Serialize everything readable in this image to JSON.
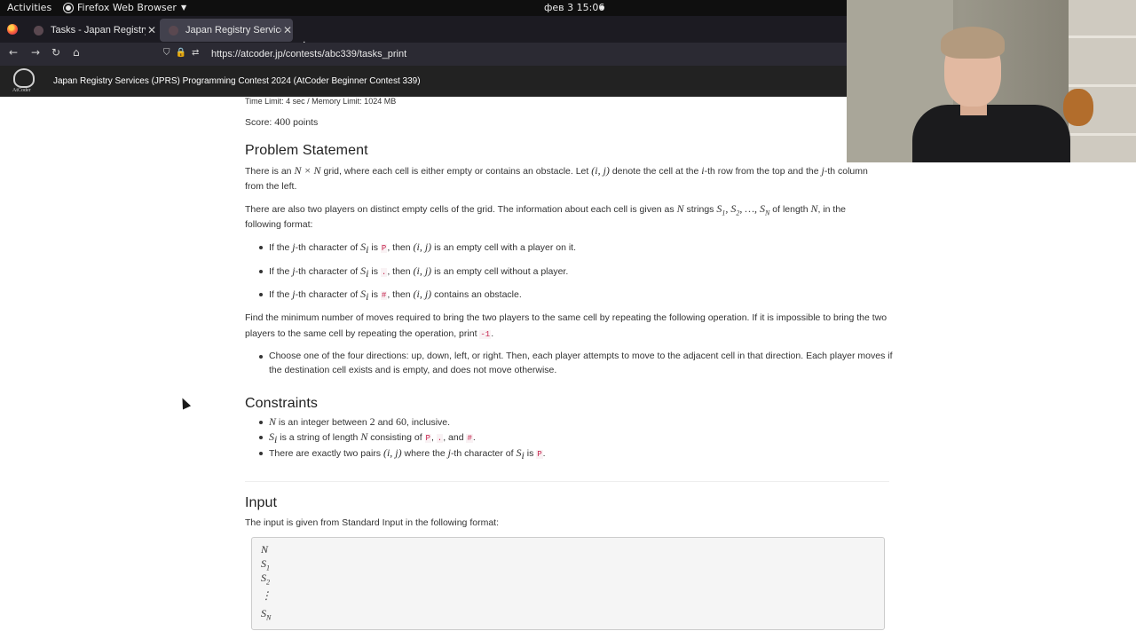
{
  "system_bar": {
    "activities": "Activities",
    "app_name": "Firefox Web Browser",
    "clock": "фев 3  15:06"
  },
  "browser": {
    "tabs": [
      {
        "label": "Tasks - Japan Registry Se",
        "active": false
      },
      {
        "label": "Japan Registry Services (",
        "active": true
      }
    ],
    "url": "https://atcoder.jp/contests/abc339/tasks_print"
  },
  "site_header": {
    "logo_text": "AtCoder",
    "contest_title": "Japan Registry Services (JPRS) Programming Contest 2024 (AtCoder Beginner Contest 339)"
  },
  "problem": {
    "limits": "Time Limit: 4 sec / Memory Limit: 1024 MB",
    "score_prefix": "Score: ",
    "score_value": "400",
    "score_suffix": " points",
    "statement_heading": "Problem Statement",
    "statement_p1": {
      "a": "There is an ",
      "math1": "N × N",
      "b": " grid, where each cell is either empty or contains an obstacle. Let ",
      "math2": "(i, j)",
      "c": " denote the cell at the ",
      "math3": "i",
      "d": "-th row from the top and the ",
      "math4": "j",
      "e": "-th column",
      "line2": "from the left."
    },
    "statement_p2": {
      "a": "There are also two players on distinct empty cells of the grid. The information about each cell is given as ",
      "math1": "N",
      "b": " strings ",
      "math2": "S",
      "c": " of length ",
      "math3": "N",
      "d": ", in the",
      "line2": "following format:"
    },
    "format_items": [
      {
        "a": "If the ",
        "j": "j",
        "b": "-th character of ",
        "s": "S",
        "sub": "i",
        "c": " is ",
        "code": "P",
        "d": ", then ",
        "cell": "(i, j)",
        "e": " is an empty cell with a player on it."
      },
      {
        "a": "If the ",
        "j": "j",
        "b": "-th character of ",
        "s": "S",
        "sub": "i",
        "c": " is ",
        "code": ".",
        "d": ", then ",
        "cell": "(i, j)",
        "e": " is an empty cell without a player."
      },
      {
        "a": "If the ",
        "j": "j",
        "b": "-th character of ",
        "s": "S",
        "sub": "i",
        "c": " is ",
        "code": "#",
        "d": ", then ",
        "cell": "(i, j)",
        "e": " contains an obstacle."
      }
    ],
    "statement_p3": {
      "line1": "Find the minimum number of moves required to bring the two players to the same cell by repeating the following operation. If it is impossible to bring the two",
      "line2a": "players to the same cell by repeating the operation, print ",
      "code": "-1",
      "line2b": "."
    },
    "operation": {
      "line1": "Choose one of the four directions: up, down, left, or right. Then, each player attempts to move to the adjacent cell in that direction. Each player moves if",
      "line2": "the destination cell exists and is empty, and does not move otherwise."
    },
    "constraints_heading": "Constraints",
    "constraints": {
      "c1": {
        "m": "N",
        "a": " is an integer between ",
        "n1": "2",
        "b": " and ",
        "n2": "60",
        "c": ", inclusive."
      },
      "c2": {
        "m": "S",
        "sub": "i",
        "a": " is a string of length ",
        "n": "N",
        "b": " consisting of ",
        "code1": "P",
        "sep1": ", ",
        "code2": ".",
        "sep2": ", and ",
        "code3": "#",
        "c": "."
      },
      "c3": {
        "a": "There are exactly two pairs ",
        "m": "(i, j)",
        "b": " where the ",
        "j": "j",
        "c": "-th character of ",
        "s": "S",
        "sub": "i",
        "d": " is ",
        "code": "P",
        "e": "."
      }
    },
    "input_heading": "Input",
    "input_text": "The input is given from Standard Input in the following format:",
    "input_format": {
      "l1": "N",
      "l2s": "S",
      "l2sub": "1",
      "l3s": "S",
      "l3sub": "2",
      "l4": "⋮",
      "l5s": "S",
      "l5sub": "N"
    }
  }
}
